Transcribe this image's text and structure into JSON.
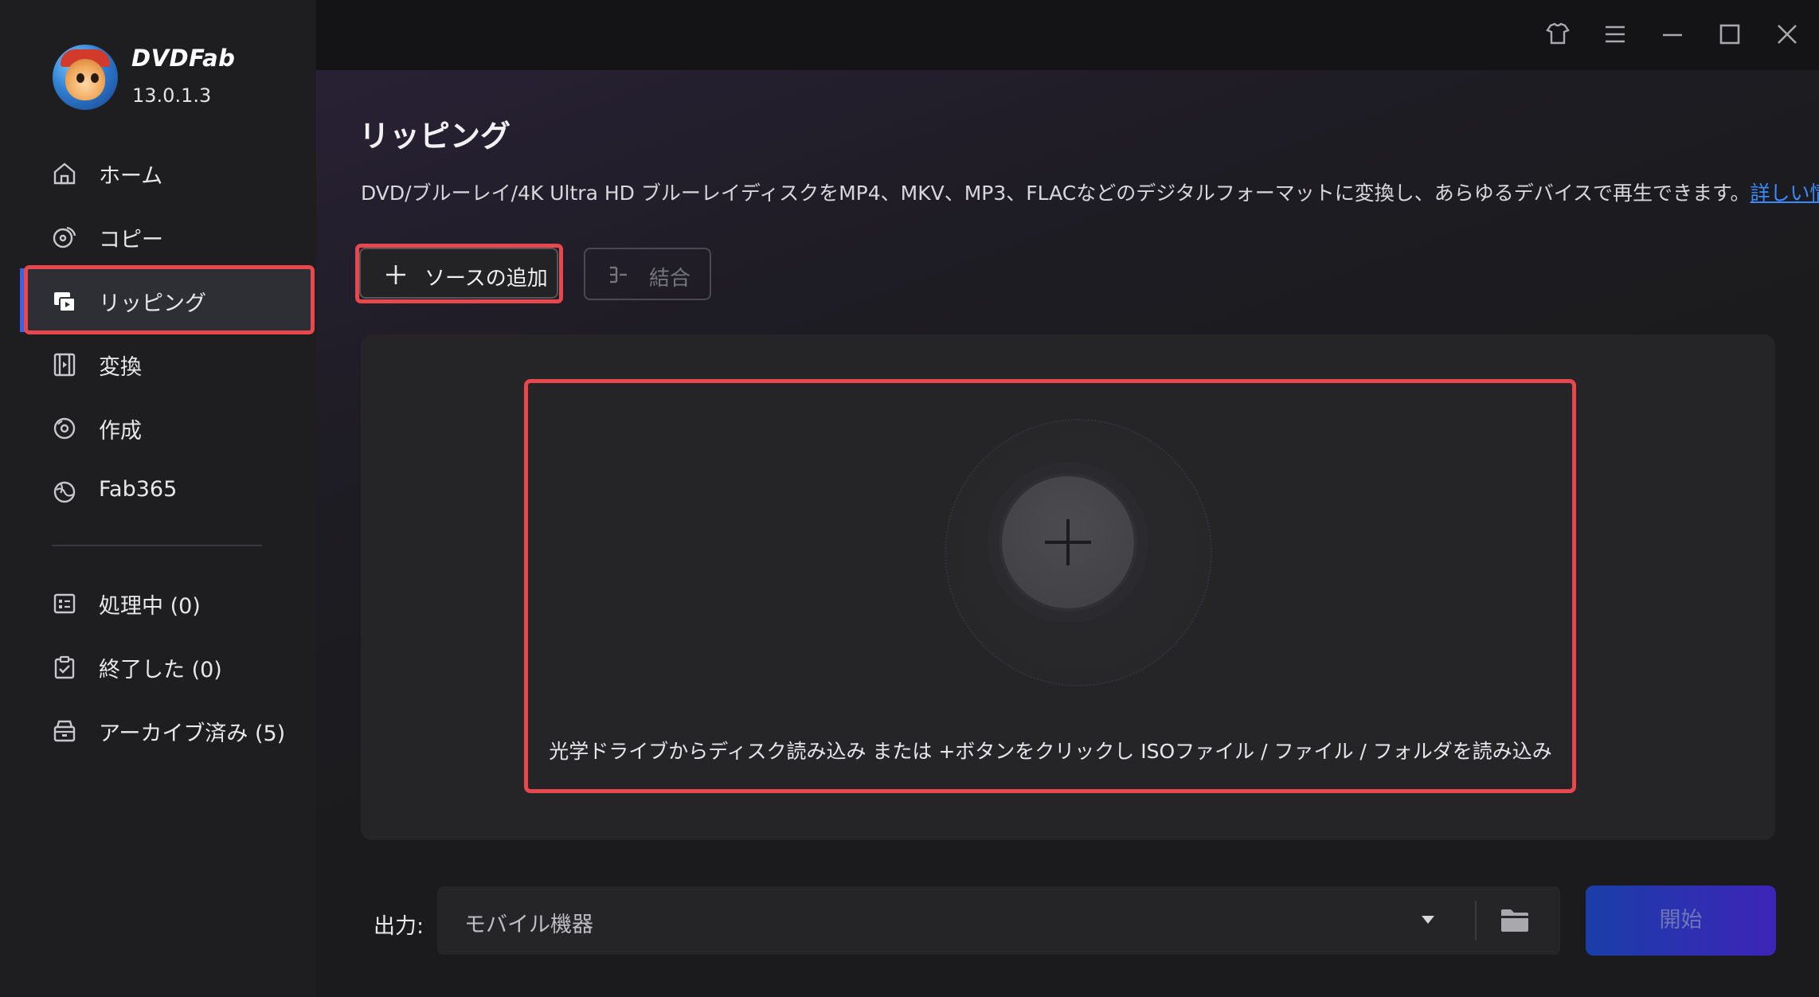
{
  "app": {
    "brand": "DVDFab",
    "version": "13.0.1.3"
  },
  "sidebar": {
    "items": [
      {
        "label": "ホーム",
        "icon": "home-icon"
      },
      {
        "label": "コピー",
        "icon": "copy-icon"
      },
      {
        "label": "リッピング",
        "icon": "ripper-icon",
        "active": true
      },
      {
        "label": "変換",
        "icon": "film-icon"
      },
      {
        "label": "作成",
        "icon": "disc-icon"
      },
      {
        "label": "Fab365",
        "icon": "fab365-icon"
      }
    ],
    "tasks": [
      {
        "label": "処理中 (0)",
        "icon": "list-icon"
      },
      {
        "label": "終了した (0)",
        "icon": "clipboard-icon"
      },
      {
        "label": "アーカイブ済み (5)",
        "icon": "archive-icon"
      }
    ]
  },
  "titlebar": {
    "icons": [
      "shirt-icon",
      "menu-icon",
      "minimize-icon",
      "maximize-icon",
      "close-icon"
    ]
  },
  "main": {
    "title": "リッピング",
    "description": "DVD/ブルーレイ/4K Ultra HD ブルーレイディスクをMP4、MKV、MP3、FLACなどのデジタルフォーマットに変換し、あらゆるデバイスで再生できます。",
    "details_link": "詳しい情報...",
    "add_source_label": "ソースの追加",
    "merge_label": "結合",
    "drop_hint": "光学ドライブからディスク読み込み または +ボタンをクリックし ISOファイル / ファイル / フォルダを読み込み"
  },
  "output": {
    "label": "出力:",
    "selected": "モバイル機器",
    "start_label": "開始"
  },
  "colors": {
    "accent": "#3a62e8",
    "highlight": "#e8484d",
    "link": "#3b8bff"
  }
}
